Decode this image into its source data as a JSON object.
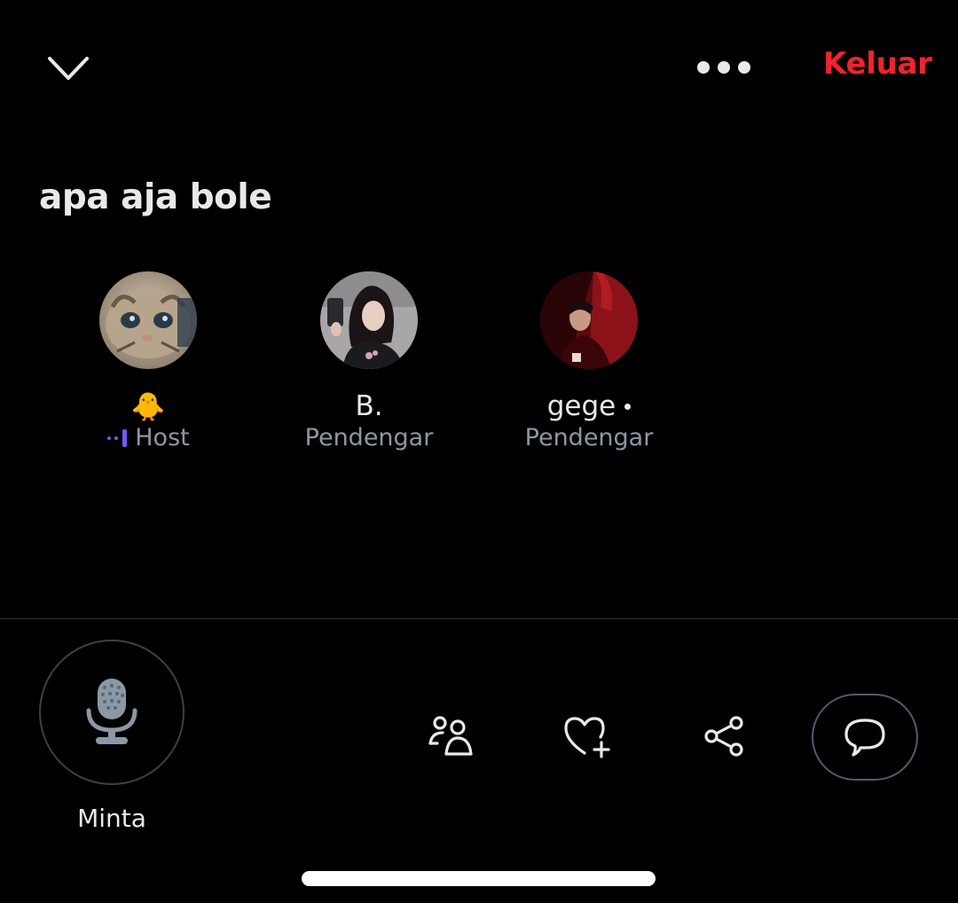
{
  "header": {
    "collapse_icon": "chevron-down-icon",
    "more_icon": "more-horizontal-icon",
    "leave_label": "Keluar",
    "leave_color": "#f4212e"
  },
  "space": {
    "title": "apa aja bole"
  },
  "participants": [
    {
      "name": "🐥",
      "role": "Host",
      "role_indicator": "speaking-indicator-icon",
      "indicator_color": "#7856ff"
    },
    {
      "name": "B.",
      "role": "Pendengar"
    },
    {
      "name": "gege",
      "role": "Pendengar",
      "online": true
    }
  ],
  "controls": {
    "mic_label": "Minta",
    "mic_icon": "microphone-icon",
    "people_icon": "people-icon",
    "react_icon": "heart-plus-icon",
    "share_icon": "share-icon",
    "chat_icon": "chat-bubble-icon"
  }
}
